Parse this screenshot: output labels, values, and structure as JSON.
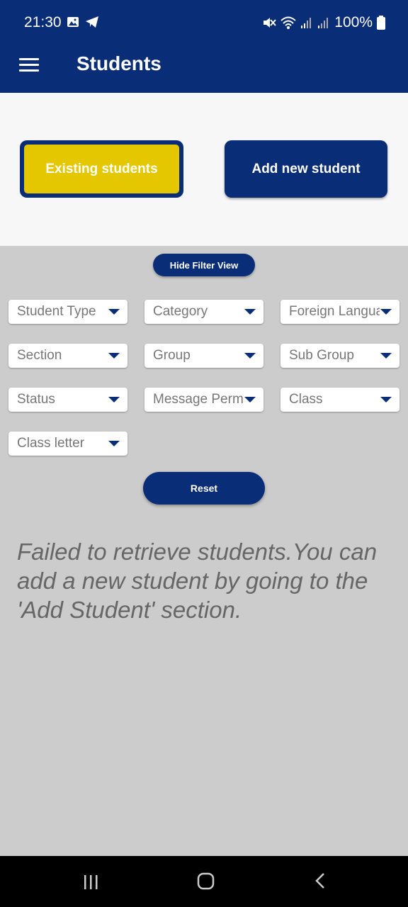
{
  "status_bar": {
    "time": "21:30",
    "battery": "100%",
    "icons": [
      "image-icon",
      "telegram-icon",
      "mute-icon",
      "wifi-icon",
      "signal-icon",
      "signal-icon",
      "battery-icon"
    ]
  },
  "app_bar": {
    "title": "Students",
    "menu_icon": "hamburger-menu-icon"
  },
  "segments": {
    "existing_label": "Existing students",
    "add_label": "Add new student",
    "selected": "Existing students"
  },
  "filter": {
    "hide_label": "Hide Filter View",
    "dropdowns": [
      "Student Type",
      "Category",
      "Foreign Langua..",
      "Section",
      "Group",
      "Sub Group",
      "Status",
      "Message Perm..",
      "Class",
      "Class letter"
    ],
    "reset_label": "Reset"
  },
  "message": "Failed to retrieve students.You can add a new student by going to the 'Add Student' section.",
  "colors": {
    "primary": "#0a2d78",
    "accent": "#e5c700",
    "background": "#cccccc"
  },
  "nav_bar": {
    "icons": [
      "recent-apps-icon",
      "home-icon",
      "back-icon"
    ]
  }
}
